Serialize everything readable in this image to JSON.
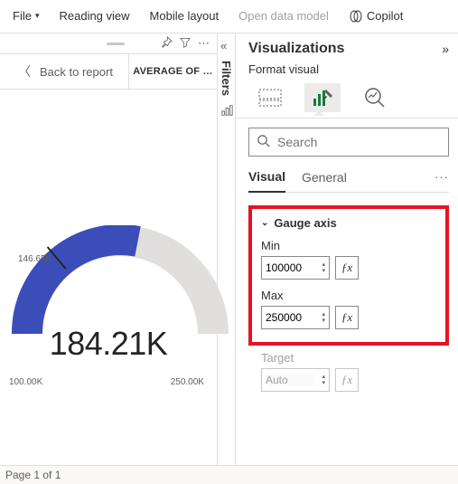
{
  "menu": {
    "file": "File",
    "reading_view": "Reading view",
    "mobile_layout": "Mobile layout",
    "open_data_model": "Open data model",
    "copilot": "Copilot"
  },
  "canvas": {
    "back_label": "Back to report",
    "header_metric": "AVERAGE OF …"
  },
  "chart_data": {
    "type": "gauge",
    "value": 184210,
    "value_label": "184.21K",
    "min": 100000,
    "min_label": "100.00K",
    "max": 250000,
    "max_label": "250.00K",
    "target": 146650,
    "target_label": "146.65K",
    "fill_color": "#3b4db8",
    "track_color": "#e1dfdd"
  },
  "filters": {
    "label": "Filters"
  },
  "viz": {
    "title": "Visualizations",
    "subtitle": "Format visual",
    "search_placeholder": "Search",
    "tabs": {
      "visual": "Visual",
      "general": "General"
    },
    "section": {
      "gauge_axis": "Gauge axis",
      "min_label": "Min",
      "min_value": "100000",
      "max_label": "Max",
      "max_value": "250000",
      "target_label": "Target",
      "target_value": "Auto"
    }
  },
  "footer": {
    "page": "Page 1 of 1"
  }
}
